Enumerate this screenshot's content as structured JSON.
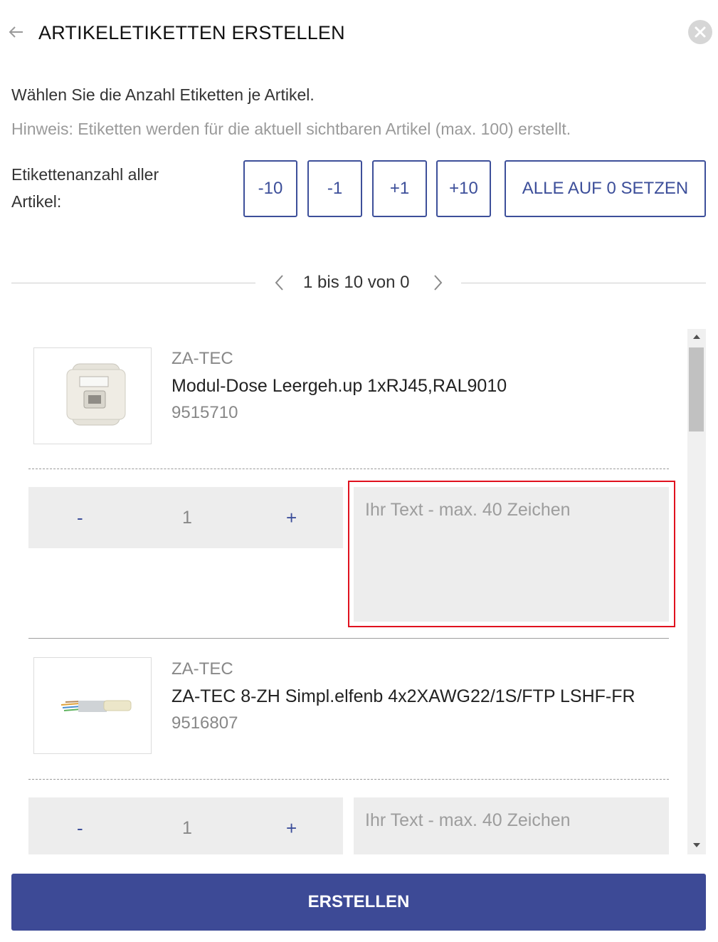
{
  "header": {
    "title": "ARTIKELETIKETTEN ERSTELLEN"
  },
  "intro": {
    "text": "Wählen Sie die Anzahl Etiketten je Artikel.",
    "hint": "Hinweis: Etiketten werden für die aktuell sichtbaren Artikel (max. 100) erstellt."
  },
  "bulk": {
    "label_line1": "Etikettenanzahl aller",
    "label_line2": "Artikel:",
    "minus10": "-10",
    "minus1": "-1",
    "plus1": "+1",
    "plus10": "+10",
    "reset": "ALLE AUF 0 SETZEN"
  },
  "pagination": {
    "text": "1 bis 10 von 0"
  },
  "items": [
    {
      "brand": "ZA-TEC",
      "name": "Modul-Dose Leergeh.up 1xRJ45,RAL9010",
      "number": "9515710",
      "minus": "-",
      "quantity": "1",
      "plus": "+",
      "text_placeholder": "Ihr Text - max. 40 Zeichen"
    },
    {
      "brand": "ZA-TEC",
      "name": "ZA-TEC 8-ZH Simpl.elfenb 4x2XAWG22/1S/FTP LSHF-FR",
      "number": "9516807",
      "minus": "-",
      "quantity": "1",
      "plus": "+",
      "text_placeholder": "Ihr Text - max. 40 Zeichen"
    }
  ],
  "footer": {
    "create": "ERSTELLEN"
  },
  "colors": {
    "accent": "#3d4a96",
    "highlight": "#e0111e"
  }
}
